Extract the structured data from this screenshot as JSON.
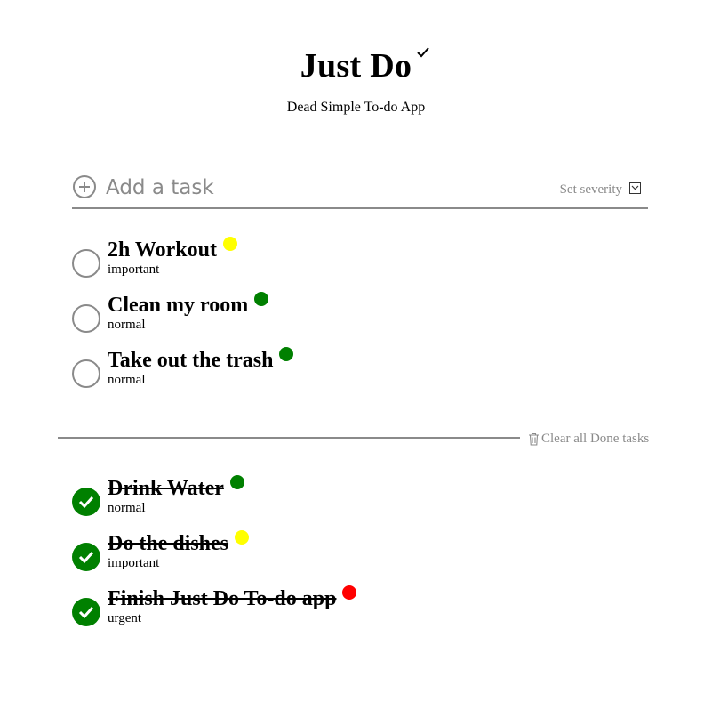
{
  "header": {
    "title": "Just Do",
    "subtitle": "Dead Simple To-do App"
  },
  "add_task": {
    "placeholder": "Add a task",
    "severity_label": "Set severity"
  },
  "colors": {
    "important": "#ffff00",
    "normal": "#008000",
    "urgent": "#ff0000",
    "muted": "#8a8a8a",
    "done": "#008000"
  },
  "active_tasks": [
    {
      "title": "2h Workout",
      "severity": "important",
      "dot_color": "#ffff00"
    },
    {
      "title": "Clean my room",
      "severity": "normal",
      "dot_color": "#008000"
    },
    {
      "title": "Take out the trash",
      "severity": "normal",
      "dot_color": "#008000"
    }
  ],
  "clear_done_label": "Clear all Done tasks",
  "done_tasks": [
    {
      "title": "Drink Water",
      "severity": "normal",
      "dot_color": "#008000"
    },
    {
      "title": "Do the dishes",
      "severity": "important",
      "dot_color": "#ffff00"
    },
    {
      "title": "Finish Just Do To-do app",
      "severity": "urgent",
      "dot_color": "#ff0000"
    }
  ],
  "icons": {
    "title_mark": "check-icon",
    "add": "plus-circle-icon",
    "severity": "chevron-down-icon",
    "clear": "trash-icon",
    "done": "check-icon"
  }
}
